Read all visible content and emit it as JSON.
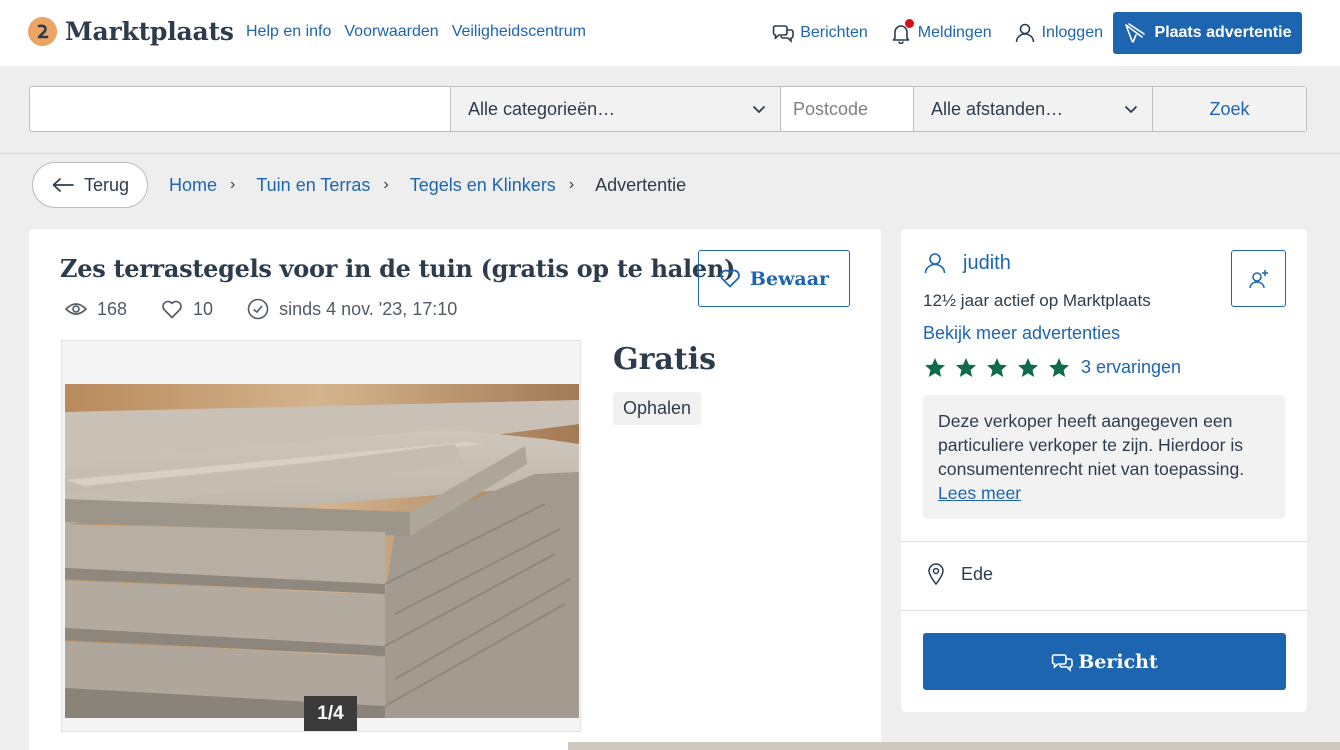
{
  "header": {
    "logo_text": "Marktplaats",
    "links": [
      "Help en info",
      "Voorwaarden",
      "Veiligheidscentrum"
    ],
    "messages_label": "Berichten",
    "notifications_label": "Meldingen",
    "login_label": "Inloggen",
    "place_ad_label": "Plaats advertentie"
  },
  "search": {
    "query": "",
    "category": "Alle categorieën…",
    "postcode_placeholder": "Postcode",
    "distance": "Alle afstanden…",
    "submit_label": "Zoek"
  },
  "breadcrumb": {
    "back_label": "Terug",
    "items": [
      "Home",
      "Tuin en Terras",
      "Tegels en Klinkers"
    ],
    "current": "Advertentie"
  },
  "listing": {
    "title": "Zes terrastegels voor in de tuin (gratis op te halen)",
    "views": "168",
    "favorites": "10",
    "since": "sinds 4 nov. '23, 17:10",
    "save_label": "Bewaar",
    "image_counter": "1/4",
    "price": "Gratis",
    "delivery": "Ophalen"
  },
  "seller": {
    "name": "judith",
    "active_since": "12½ jaar actief op Marktplaats",
    "more_ads_label": "Bekijk meer advertenties",
    "rating_stars": 5,
    "reviews_label": "3 ervaringen",
    "notice_text": "Deze verkoper heeft aangegeven een particuliere verkoper te zijn. Hierdoor is consumentenrecht niet van toepassing.",
    "notice_link": "Lees meer",
    "location": "Ede",
    "message_button_label": "Bericht"
  },
  "colors": {
    "brand_blue": "#1d65b1",
    "logo_orange": "#eda566",
    "star_green": "#0f6b4b",
    "notification_red": "#d80f18"
  }
}
